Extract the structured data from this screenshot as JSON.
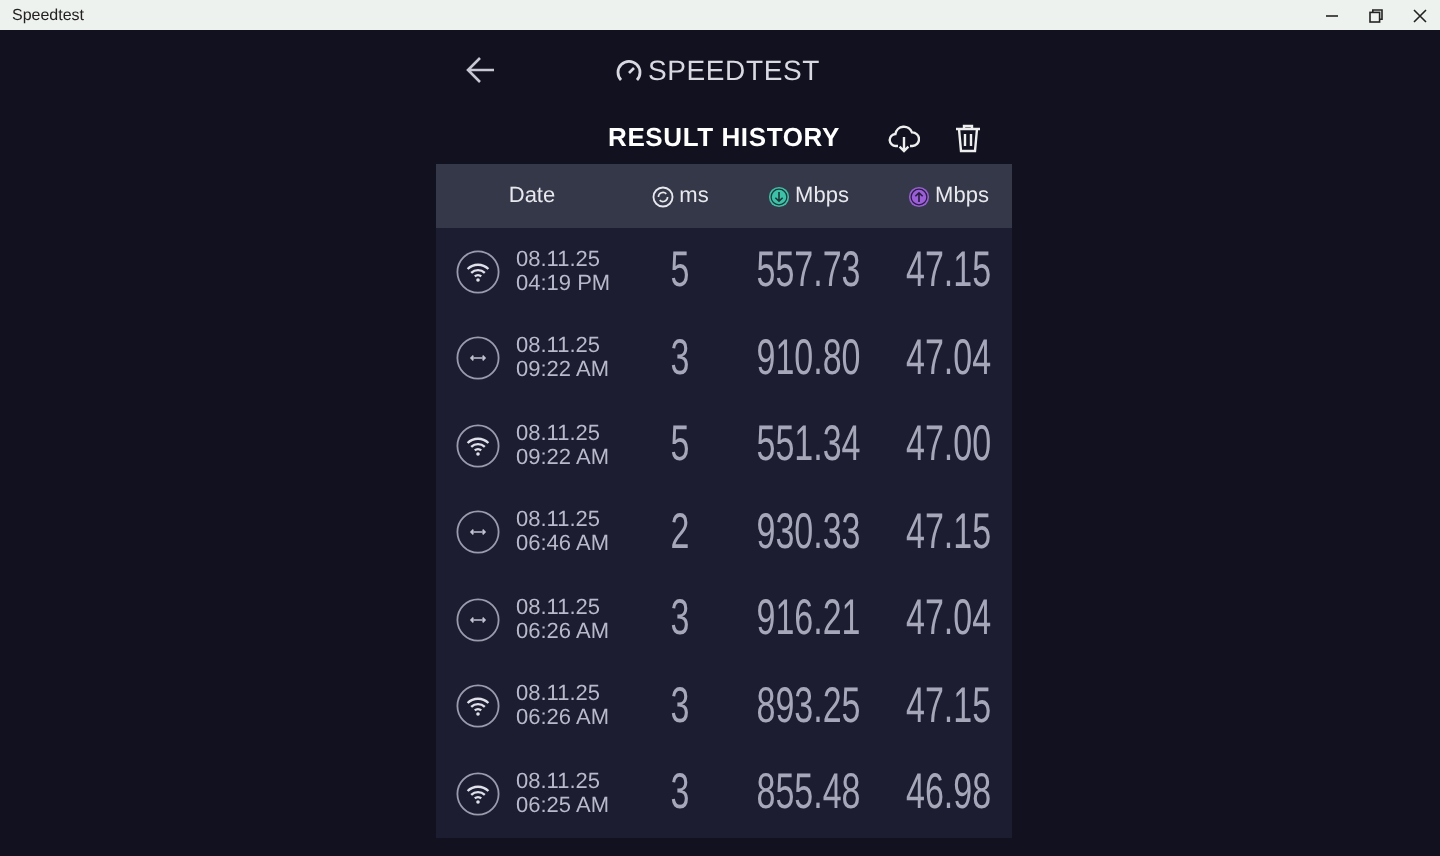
{
  "window": {
    "title": "Speedtest"
  },
  "logo": "SPEEDTEST",
  "page_title": "RESULT HISTORY",
  "columns": [
    {
      "kind": "date",
      "label": "Date"
    },
    {
      "kind": "ping",
      "label": "ms"
    },
    {
      "kind": "download",
      "label": "Mbps"
    },
    {
      "kind": "upload",
      "label": "Mbps"
    }
  ],
  "rows": [
    {
      "kind": "wifi",
      "date": "08.11.25",
      "time": "04:19 PM",
      "ping": "5",
      "download": "557.73",
      "upload": "47.15"
    },
    {
      "kind": "ethernet",
      "date": "08.11.25",
      "time": "09:22 AM",
      "ping": "3",
      "download": "910.80",
      "upload": "47.04"
    },
    {
      "kind": "wifi",
      "date": "08.11.25",
      "time": "09:22 AM",
      "ping": "5",
      "download": "551.34",
      "upload": "47.00"
    },
    {
      "kind": "ethernet",
      "date": "08.11.25",
      "time": "06:46 AM",
      "ping": "2",
      "download": "930.33",
      "upload": "47.15"
    },
    {
      "kind": "ethernet",
      "date": "08.11.25",
      "time": "06:26 AM",
      "ping": "3",
      "download": "916.21",
      "upload": "47.04"
    },
    {
      "kind": "wifi",
      "date": "08.11.25",
      "time": "06:26 AM",
      "ping": "3",
      "download": "893.25",
      "upload": "47.15"
    },
    {
      "kind": "wifi",
      "date": "08.11.25",
      "time": "06:25 AM",
      "ping": "3",
      "download": "855.48",
      "upload": "46.98"
    }
  ]
}
